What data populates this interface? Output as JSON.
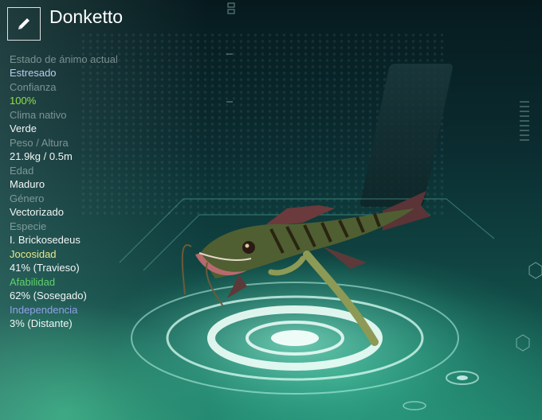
{
  "creature": {
    "name": "Donketto"
  },
  "stats": [
    {
      "label": "Estado de ánimo actual",
      "value": "Estresado"
    },
    {
      "label": "Confianza",
      "value": "100%"
    },
    {
      "label": "Clima nativo",
      "value": "Verde"
    },
    {
      "label": "Peso / Altura",
      "value": "21.9kg / 0.5m"
    },
    {
      "label": "Edad",
      "value": "Maduro"
    },
    {
      "label": "Género",
      "value": "Vectorizado"
    },
    {
      "label": "Especie",
      "value": "I. Brickosedeus"
    },
    {
      "label": "Jocosidad",
      "value": "41% (Travieso)"
    },
    {
      "label": "Afabilidad",
      "value": "62% (Sosegado)"
    },
    {
      "label": "Independencia",
      "value": "3% (Distante)"
    }
  ],
  "colors": {
    "mood_value": "#b9cdf0",
    "trust_value": "#8ee04a",
    "playfulness_label": "#e6e88a",
    "friendliness_label": "#5fd26a",
    "independence_label": "#8fa0e8"
  },
  "icons": {
    "edit": "pencil-icon"
  }
}
